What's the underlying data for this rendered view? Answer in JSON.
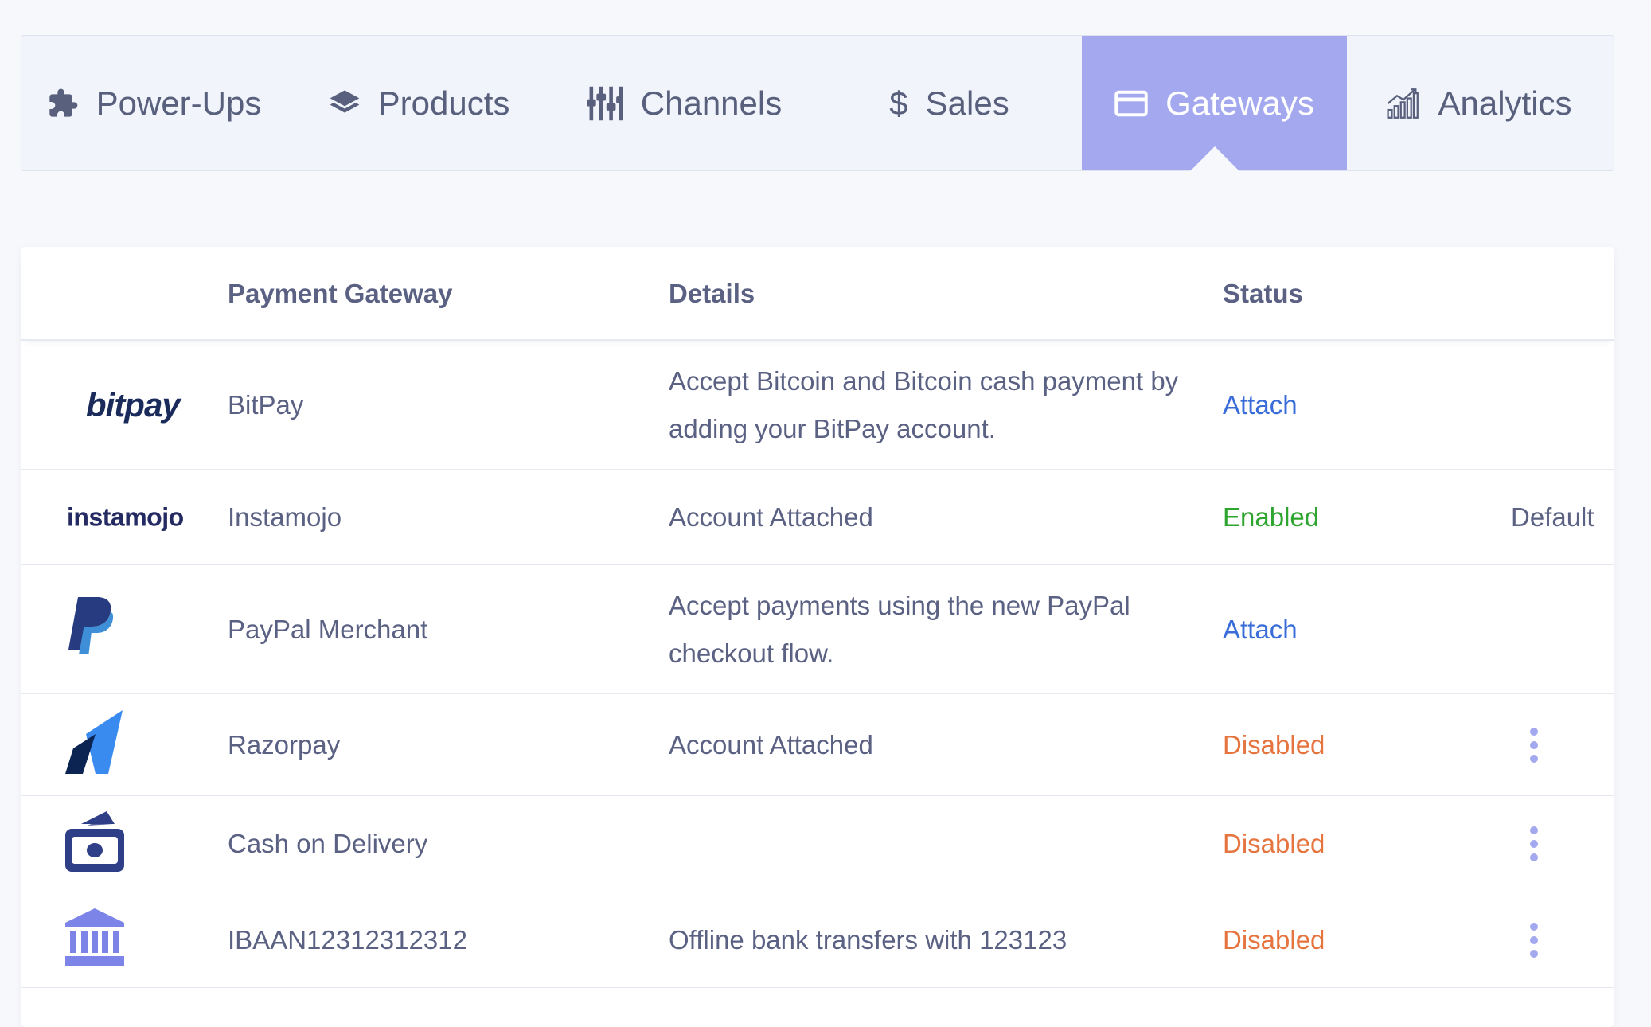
{
  "tabs": [
    {
      "label": "Power-Ups",
      "icon": "puzzle-icon",
      "active": false
    },
    {
      "label": "Products",
      "icon": "layers-icon",
      "active": false
    },
    {
      "label": "Channels",
      "icon": "sliders-icon",
      "active": false
    },
    {
      "label": "Sales",
      "icon": "dollar-icon",
      "active": false
    },
    {
      "label": "Gateways",
      "icon": "credit-card-icon",
      "active": true
    },
    {
      "label": "Analytics",
      "icon": "bar-chart-icon",
      "active": false
    }
  ],
  "table": {
    "headers": {
      "gateway": "Payment Gateway",
      "details": "Details",
      "status": "Status"
    },
    "rows": [
      {
        "logo": "bitpay-logo",
        "logo_text": "bitpay",
        "name": "BitPay",
        "details": "Accept Bitcoin and Bitcoin cash payment by adding your BitPay account.",
        "status": "Attach",
        "extra": ""
      },
      {
        "logo": "instamojo-logo",
        "logo_text": "instamojo",
        "name": "Instamojo",
        "details": "Account Attached",
        "status": "Enabled",
        "extra": "Default"
      },
      {
        "logo": "paypal-logo",
        "name": "PayPal Merchant",
        "details": "Accept payments using the new PayPal checkout flow.",
        "status": "Attach",
        "extra": ""
      },
      {
        "logo": "razorpay-logo",
        "name": "Razorpay",
        "details": "Account Attached",
        "status": "Disabled",
        "extra": ""
      },
      {
        "logo": "cash-icon",
        "name": "Cash on Delivery",
        "details": "",
        "status": "Disabled",
        "extra": ""
      },
      {
        "logo": "bank-icon",
        "name": "IBAAN12312312312",
        "details": "Offline bank transfers with 123123",
        "status": "Disabled",
        "extra": ""
      }
    ]
  },
  "colors": {
    "accent": "#a4a9ef",
    "attach": "#3a6cd9",
    "enabled": "#2ea52e",
    "disabled": "#e6743f"
  }
}
